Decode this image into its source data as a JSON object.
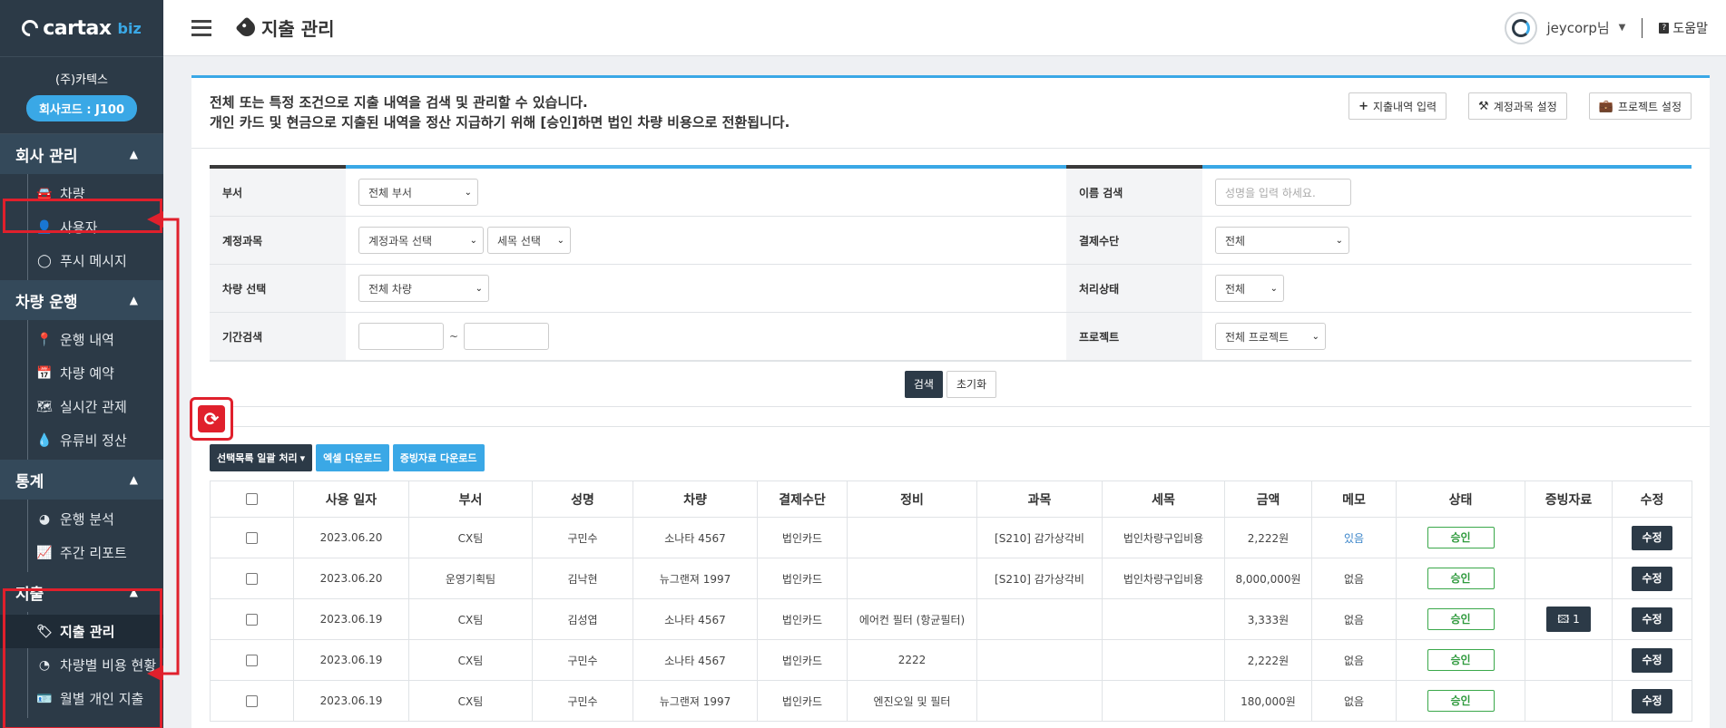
{
  "brand": {
    "logo_text": "cartax",
    "logo_suffix": "biz"
  },
  "company": {
    "name": "(주)카텍스",
    "code_label": "회사코드 : J100"
  },
  "sidebar": {
    "groups": [
      {
        "title": "회사 관리",
        "items": [
          {
            "label": "차량",
            "icon": "car-icon"
          },
          {
            "label": "사용자",
            "icon": "user-add-icon"
          },
          {
            "label": "푸시 메시지",
            "icon": "chat-bubble-icon"
          }
        ]
      },
      {
        "title": "차량 운행",
        "items": [
          {
            "label": "운행 내역",
            "icon": "map-pin-icon"
          },
          {
            "label": "차량 예약",
            "icon": "calendar-plus-icon"
          },
          {
            "label": "실시간 관제",
            "icon": "map-icon"
          },
          {
            "label": "유류비 정산",
            "icon": "drop-icon"
          }
        ]
      },
      {
        "title": "통계",
        "items": [
          {
            "label": "운행 분석",
            "icon": "pie-chart-icon"
          },
          {
            "label": "주간 리포트",
            "icon": "area-chart-icon"
          }
        ]
      },
      {
        "title": "지출",
        "items": [
          {
            "label": "지출 관리",
            "icon": "tag-icon"
          },
          {
            "label": "차량별 비용 현황",
            "icon": "gauge-icon"
          },
          {
            "label": "월별 개인 지출",
            "icon": "id-card-icon"
          }
        ]
      }
    ]
  },
  "topbar": {
    "title": "지출 관리",
    "username": "jeycorp님",
    "help_label": "도움말"
  },
  "info": {
    "line1": "전체 또는 특정 조건으로 지출 내역을 검색 및 관리할 수 있습니다.",
    "line2": "개인 카드 및 현금으로 지출된 내역을 정산 지급하기 위해 [승인]하면 법인 차량 비용으로 전환됩니다.",
    "buttons": [
      "지출내역 입력",
      "계정과목 설정",
      "프로젝트 설정"
    ]
  },
  "filter": {
    "dept_label": "부서",
    "dept_value": "전체 부서",
    "name_label": "이름 검색",
    "name_placeholder": "성명을 입력 하세요.",
    "account_label": "계정과목",
    "account_value": "계정과목 선택",
    "subaccount_value": "세목 선택",
    "payment_label": "결제수단",
    "payment_value": "전체",
    "vehicle_label": "차량 선택",
    "vehicle_value": "전체 차량",
    "status_label": "처리상태",
    "status_value": "전체",
    "period_label": "기간검색",
    "period_sep": "~",
    "project_label": "프로젝트",
    "project_value": "전체 프로젝트",
    "search_btn": "검색",
    "reset_btn": "초기화"
  },
  "actions": {
    "bulk": "선택목록 일괄 처리",
    "excel": "엑셀 다운로드",
    "evidence": "증빙자료 다운로드"
  },
  "table": {
    "headers": [
      "사용 일자",
      "부서",
      "성명",
      "차량",
      "결제수단",
      "정비",
      "과목",
      "세목",
      "금액",
      "메모",
      "상태",
      "증빙자료",
      "수정"
    ],
    "rows": [
      {
        "date": "2023.06.20",
        "dept": "CX팀",
        "name": "구민수",
        "car": "소나타 4567",
        "pay": "법인카드",
        "maint": "",
        "subject": "[S210] 감가상각비",
        "detail": "법인차량구입비용",
        "amount": "2,222원",
        "memo": "있음",
        "status": "승인",
        "doc": "",
        "edit": "수정"
      },
      {
        "date": "2023.06.20",
        "dept": "운영기획팀",
        "name": "김낙현",
        "car": "뉴그랜져 1997",
        "pay": "법인카드",
        "maint": "",
        "subject": "[S210] 감가상각비",
        "detail": "법인차량구입비용",
        "amount": "8,000,000원",
        "memo": "없음",
        "status": "승인",
        "doc": "",
        "edit": "수정"
      },
      {
        "date": "2023.06.19",
        "dept": "CX팀",
        "name": "김성엽",
        "car": "소나타 4567",
        "pay": "법인카드",
        "maint": "에어컨 필터 (항균필터)",
        "subject": "",
        "detail": "",
        "amount": "3,333원",
        "memo": "없음",
        "status": "승인",
        "doc": "1",
        "edit": "수정"
      },
      {
        "date": "2023.06.19",
        "dept": "CX팀",
        "name": "구민수",
        "car": "소나타 4567",
        "pay": "법인카드",
        "maint": "2222",
        "subject": "",
        "detail": "",
        "amount": "2,222원",
        "memo": "없음",
        "status": "승인",
        "doc": "",
        "edit": "수정"
      },
      {
        "date": "2023.06.19",
        "dept": "CX팀",
        "name": "구민수",
        "car": "뉴그랜져 1997",
        "pay": "법인카드",
        "maint": "엔진오일 및 필터",
        "subject": "",
        "detail": "",
        "amount": "180,000원",
        "memo": "없음",
        "status": "승인",
        "doc": "",
        "edit": "수정"
      }
    ]
  },
  "colors": {
    "sidebar": "#2c3a47",
    "accent": "#3aa8e6",
    "annotation": "#e0202c",
    "approved": "#2e9a3c"
  }
}
